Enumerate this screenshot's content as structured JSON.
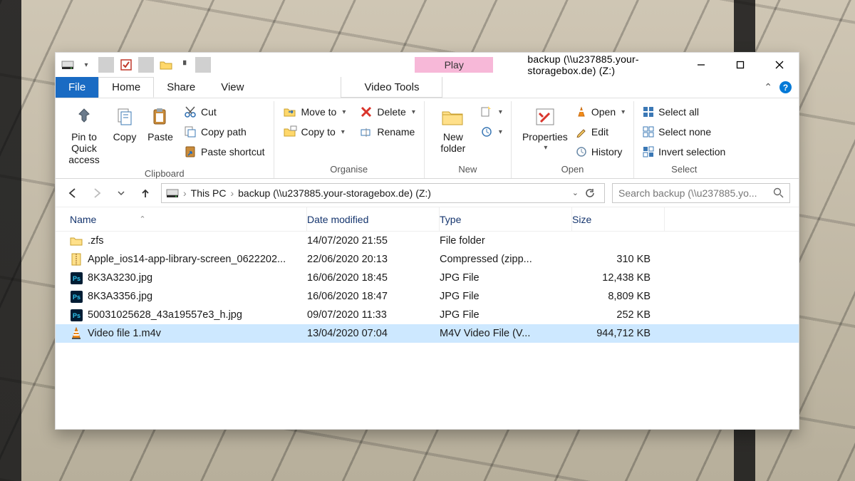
{
  "title": "backup (\\\\u237885.your-storagebox.de) (Z:)",
  "play_tab": "Play",
  "menu": {
    "file": "File",
    "home": "Home",
    "share": "Share",
    "view": "View",
    "video_tools": "Video Tools"
  },
  "ribbon": {
    "pin": "Pin to Quick access",
    "copy": "Copy",
    "paste": "Paste",
    "cut": "Cut",
    "copy_path": "Copy path",
    "paste_shortcut": "Paste shortcut",
    "clipboard": "Clipboard",
    "move_to": "Move to",
    "copy_to": "Copy to",
    "delete": "Delete",
    "rename": "Rename",
    "organise": "Organise",
    "new_folder": "New folder",
    "new": "New",
    "properties": "Properties",
    "open": "Open",
    "edit": "Edit",
    "history": "History",
    "open_grp": "Open",
    "select_all": "Select all",
    "select_none": "Select none",
    "invert": "Invert selection",
    "select_grp": "Select"
  },
  "breadcrumb": {
    "root": "This PC",
    "folder": "backup (\\\\u237885.your-storagebox.de) (Z:)"
  },
  "search_placeholder": "Search backup (\\\\u237885.yo...",
  "columns": {
    "name": "Name",
    "date": "Date modified",
    "type": "Type",
    "size": "Size"
  },
  "files": [
    {
      "icon": "folder",
      "name": ".zfs",
      "date": "14/07/2020 21:55",
      "type": "File folder",
      "size": ""
    },
    {
      "icon": "zip",
      "name": "Apple_ios14-app-library-screen_0622202...",
      "date": "22/06/2020 20:13",
      "type": "Compressed (zipp...",
      "size": "310 KB"
    },
    {
      "icon": "ps",
      "name": "8K3A3230.jpg",
      "date": "16/06/2020 18:45",
      "type": "JPG File",
      "size": "12,438 KB"
    },
    {
      "icon": "ps",
      "name": "8K3A3356.jpg",
      "date": "16/06/2020 18:47",
      "type": "JPG File",
      "size": "8,809 KB"
    },
    {
      "icon": "ps",
      "name": "50031025628_43a19557e3_h.jpg",
      "date": "09/07/2020 11:33",
      "type": "JPG File",
      "size": "252 KB"
    },
    {
      "icon": "vlc",
      "name": "Video file 1.m4v",
      "date": "13/04/2020 07:04",
      "type": "M4V Video File (V...",
      "size": "944,712 KB",
      "selected": true
    }
  ]
}
